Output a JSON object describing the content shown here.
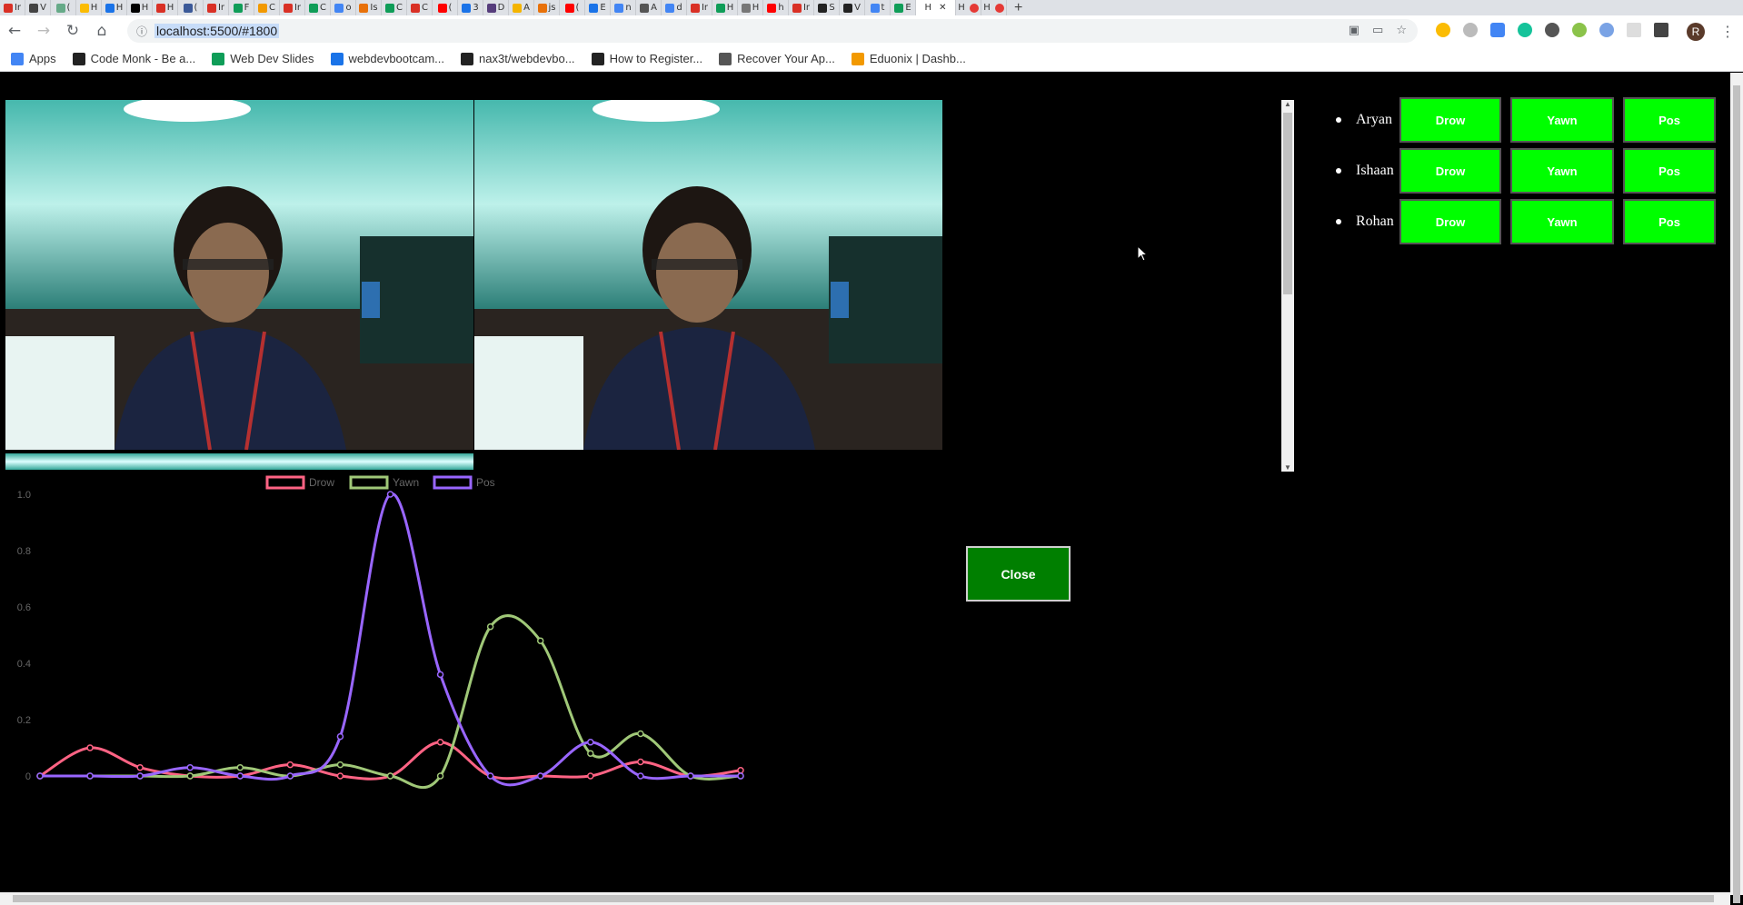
{
  "browser": {
    "tabs": [
      {
        "fav": "#d93025",
        "letter": "Ir"
      },
      {
        "fav": "#444",
        "letter": "V"
      },
      {
        "fav": "#6a8",
        "letter": "("
      },
      {
        "fav": "#fbbc04",
        "letter": "H"
      },
      {
        "fav": "#1a73e8",
        "letter": "H"
      },
      {
        "fav": "#000",
        "letter": "H"
      },
      {
        "fav": "#d93025",
        "letter": "H"
      },
      {
        "fav": "#3b5998",
        "letter": "("
      },
      {
        "fav": "#d93025",
        "letter": "Ir"
      },
      {
        "fav": "#0f9d58",
        "letter": "F"
      },
      {
        "fav": "#f29900",
        "letter": "C"
      },
      {
        "fav": "#d93025",
        "letter": "Ir"
      },
      {
        "fav": "#0f9d58",
        "letter": "C"
      },
      {
        "fav": "#4285f4",
        "letter": "o"
      },
      {
        "fav": "#e8710a",
        "letter": "Is"
      },
      {
        "fav": "#0f9d58",
        "letter": "C"
      },
      {
        "fav": "#d93025",
        "letter": "C"
      },
      {
        "fav": "#ff0000",
        "letter": "("
      },
      {
        "fav": "#1a73e8",
        "letter": "3"
      },
      {
        "fav": "#563d7c",
        "letter": "D"
      },
      {
        "fav": "#f4b400",
        "letter": "A"
      },
      {
        "fav": "#e8710a",
        "letter": "js"
      },
      {
        "fav": "#ff0000",
        "letter": "("
      },
      {
        "fav": "#1a73e8",
        "letter": "E"
      },
      {
        "fav": "#4285f4",
        "letter": "n"
      },
      {
        "fav": "#555",
        "letter": "A"
      },
      {
        "fav": "#4285f4",
        "letter": "d"
      },
      {
        "fav": "#d93025",
        "letter": "Ir"
      },
      {
        "fav": "#0f9d58",
        "letter": "H"
      },
      {
        "fav": "#777",
        "letter": "H"
      },
      {
        "fav": "#ff0000",
        "letter": "h"
      },
      {
        "fav": "#d93025",
        "letter": "Ir"
      },
      {
        "fav": "#222",
        "letter": "S"
      },
      {
        "fav": "#222",
        "letter": "V"
      },
      {
        "fav": "#4285f4",
        "letter": "t"
      },
      {
        "fav": "#0f9d58",
        "letter": "E"
      }
    ],
    "active_tab_label": "H",
    "extra_tabs": [
      "H",
      "H"
    ],
    "new_tab_symbol": "+",
    "url": "localhost:5500/#1800",
    "bookmarks": [
      {
        "label": "Apps",
        "color": "#4285f4"
      },
      {
        "label": "Code Monk - Be a...",
        "color": "#222"
      },
      {
        "label": "Web Dev Slides",
        "color": "#0f9d58"
      },
      {
        "label": "webdevbootcam...",
        "color": "#1a73e8"
      },
      {
        "label": "nax3t/webdevbo...",
        "color": "#222"
      },
      {
        "label": "How to Register...",
        "color": "#222"
      },
      {
        "label": "Recover Your Ap...",
        "color": "#555"
      },
      {
        "label": "Eduonix | Dashb...",
        "color": "#f29900"
      }
    ],
    "avatar_letter": "R"
  },
  "users": [
    {
      "name": "Aryan",
      "drow": "Drow",
      "yawn": "Yawn",
      "pos": "Pos"
    },
    {
      "name": "Ishaan",
      "drow": "Drow",
      "yawn": "Yawn",
      "pos": "Pos"
    },
    {
      "name": "Rohan",
      "drow": "Drow",
      "yawn": "Yawn",
      "pos": "Pos"
    }
  ],
  "close_label": "Close",
  "colors": {
    "button_green": "#00ff00",
    "close_green": "#007f00",
    "drow": "#ff6384",
    "yawn": "#a0c878",
    "pos": "#9966ff"
  },
  "chart_data": {
    "type": "line",
    "x": [
      0,
      1,
      2,
      3,
      4,
      5,
      6,
      7,
      8,
      9,
      10,
      11,
      12,
      13,
      14
    ],
    "ylim": [
      0,
      1.0
    ],
    "yticks": [
      "1.0",
      "0.8",
      "0.6",
      "0.4",
      "0.2",
      "0"
    ],
    "series": [
      {
        "name": "Drow",
        "color": "#ff6384",
        "values": [
          0,
          0.1,
          0.03,
          0,
          0,
          0.04,
          0,
          0,
          0.12,
          0,
          0,
          0,
          0.05,
          0,
          0.02
        ]
      },
      {
        "name": "Yawn",
        "color": "#a0c878",
        "values": [
          0,
          0,
          0,
          0,
          0.03,
          0,
          0.04,
          0,
          0,
          0.53,
          0.48,
          0.08,
          0.15,
          0,
          0
        ]
      },
      {
        "name": "Pos",
        "color": "#9966ff",
        "values": [
          0,
          0,
          0,
          0.03,
          0,
          0,
          0.14,
          1.0,
          0.36,
          0,
          0,
          0.12,
          0,
          0,
          0
        ]
      }
    ]
  }
}
